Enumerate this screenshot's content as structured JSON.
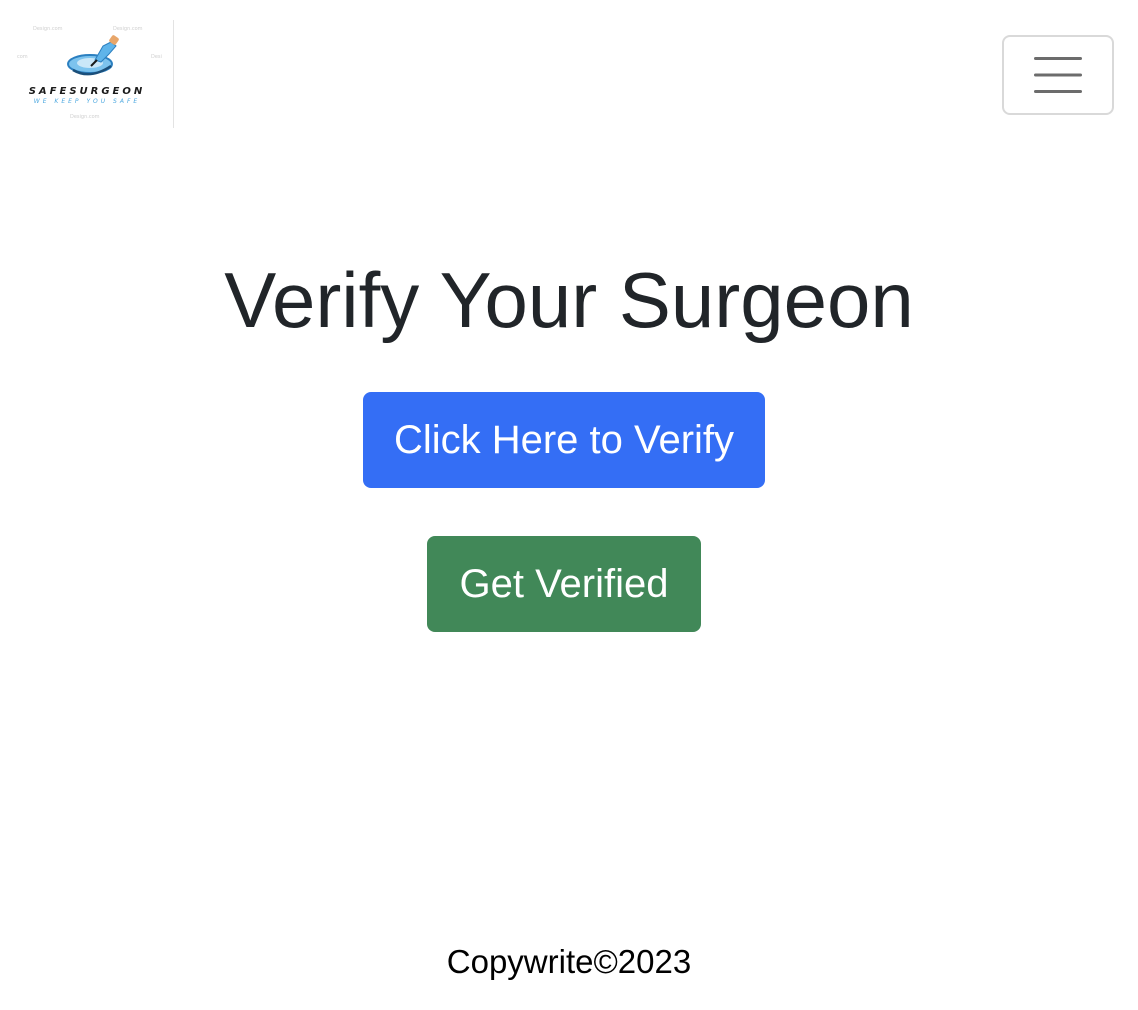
{
  "navbar": {
    "logo": {
      "name": "SAFESURGEON",
      "tagline": "WE KEEP YOU SAFE",
      "icon": "gloved-hand-scalpel-logo"
    },
    "toggler_icon": "hamburger-menu-icon"
  },
  "hero": {
    "title": "Verify Your Surgeon",
    "verify_button_label": "Click Here to Verify",
    "get_verified_button_label": "Get Verified"
  },
  "footer": {
    "copyright": "Copywrite©2023"
  },
  "colors": {
    "primary": "#346ef5",
    "success": "#418858",
    "text_dark": "#212529",
    "logo_accent": "#4fa9e0"
  }
}
